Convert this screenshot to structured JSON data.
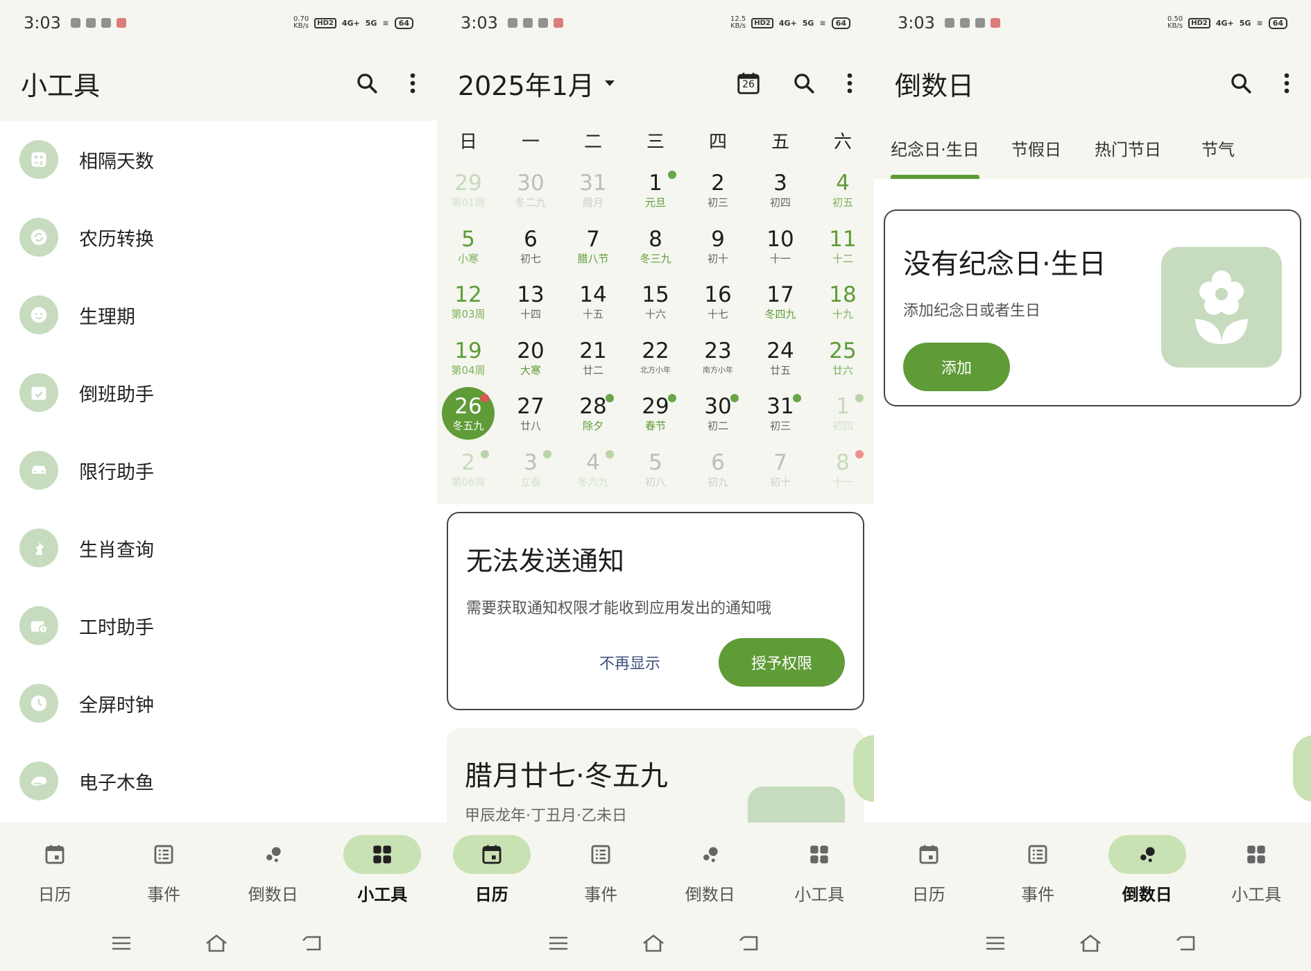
{
  "status": {
    "time": "3:03",
    "s1_speed": "0.70",
    "s2_speed": "12.5",
    "s3_speed": "0.50",
    "speed_unit": "KB/s",
    "hd": "HD2",
    "net1": "4G+",
    "net2": "5G",
    "battery": "64"
  },
  "tools_screen": {
    "title": "小工具",
    "items": [
      {
        "label": "相隔天数",
        "icon": "calculator-icon"
      },
      {
        "label": "农历转换",
        "icon": "sync-icon"
      },
      {
        "label": "生理期",
        "icon": "face-icon"
      },
      {
        "label": "倒班助手",
        "icon": "calendar-check-icon"
      },
      {
        "label": "限行助手",
        "icon": "car-icon"
      },
      {
        "label": "生肖查询",
        "icon": "zodiac-icon"
      },
      {
        "label": "工时助手",
        "icon": "work-timer-icon"
      },
      {
        "label": "全屏时钟",
        "icon": "clock-icon"
      },
      {
        "label": "电子木鱼",
        "icon": "wooden-fish-icon"
      }
    ]
  },
  "calendar_screen": {
    "month_title": "2025年1月",
    "today_icon_num": "26",
    "weekdays": [
      "日",
      "一",
      "二",
      "三",
      "四",
      "五",
      "六"
    ],
    "weeks": [
      [
        {
          "d": "29",
          "l": "第01周"
        },
        {
          "d": "30",
          "l": "冬二九"
        },
        {
          "d": "31",
          "l": "腊月"
        },
        {
          "d": "1",
          "l": "元旦"
        },
        {
          "d": "2",
          "l": "初三"
        },
        {
          "d": "3",
          "l": "初四"
        },
        {
          "d": "4",
          "l": "初五"
        }
      ],
      [
        {
          "d": "5",
          "l": "小寒"
        },
        {
          "d": "6",
          "l": "初七"
        },
        {
          "d": "7",
          "l": "腊八节"
        },
        {
          "d": "8",
          "l": "冬三九"
        },
        {
          "d": "9",
          "l": "初十"
        },
        {
          "d": "10",
          "l": "十一"
        },
        {
          "d": "11",
          "l": "十二"
        }
      ],
      [
        {
          "d": "12",
          "l": "第03周"
        },
        {
          "d": "13",
          "l": "十四"
        },
        {
          "d": "14",
          "l": "十五"
        },
        {
          "d": "15",
          "l": "十六"
        },
        {
          "d": "16",
          "l": "十七"
        },
        {
          "d": "17",
          "l": "冬四九"
        },
        {
          "d": "18",
          "l": "十九"
        }
      ],
      [
        {
          "d": "19",
          "l": "第04周"
        },
        {
          "d": "20",
          "l": "大寒"
        },
        {
          "d": "21",
          "l": "廿二"
        },
        {
          "d": "22",
          "l": "北方小年"
        },
        {
          "d": "23",
          "l": "南方小年"
        },
        {
          "d": "24",
          "l": "廿五"
        },
        {
          "d": "25",
          "l": "廿六"
        }
      ],
      [
        {
          "d": "26",
          "l": "冬五九"
        },
        {
          "d": "27",
          "l": "廿八"
        },
        {
          "d": "28",
          "l": "除夕"
        },
        {
          "d": "29",
          "l": "春节"
        },
        {
          "d": "30",
          "l": "初二"
        },
        {
          "d": "31",
          "l": "初三"
        },
        {
          "d": "1",
          "l": "初四"
        }
      ],
      [
        {
          "d": "2",
          "l": "第06周"
        },
        {
          "d": "3",
          "l": "立春"
        },
        {
          "d": "4",
          "l": "冬六九"
        },
        {
          "d": "5",
          "l": "初八"
        },
        {
          "d": "6",
          "l": "初九"
        },
        {
          "d": "7",
          "l": "初十"
        },
        {
          "d": "8",
          "l": "十一"
        }
      ]
    ],
    "notice": {
      "title": "无法发送通知",
      "desc": "需要获取通知权限才能收到应用发出的通知哦",
      "dismiss": "不再显示",
      "grant": "授予权限"
    },
    "lunar": {
      "title": "腊月廿七·冬五九",
      "sub": "甲辰龙年·丁丑月·乙未日"
    }
  },
  "countdown_screen": {
    "title": "倒数日",
    "tabs": [
      "纪念日·生日",
      "节假日",
      "热门节日",
      "节气"
    ],
    "empty": {
      "title": "没有纪念日·生日",
      "desc": "添加纪念日或者生日",
      "add": "添加"
    }
  },
  "nav": {
    "calendar": "日历",
    "events": "事件",
    "countdown": "倒数日",
    "tools": "小工具"
  },
  "colors": {
    "accent": "#5f9b37",
    "accent_light": "#c9e2b4",
    "surface": "#f4f6ef"
  }
}
